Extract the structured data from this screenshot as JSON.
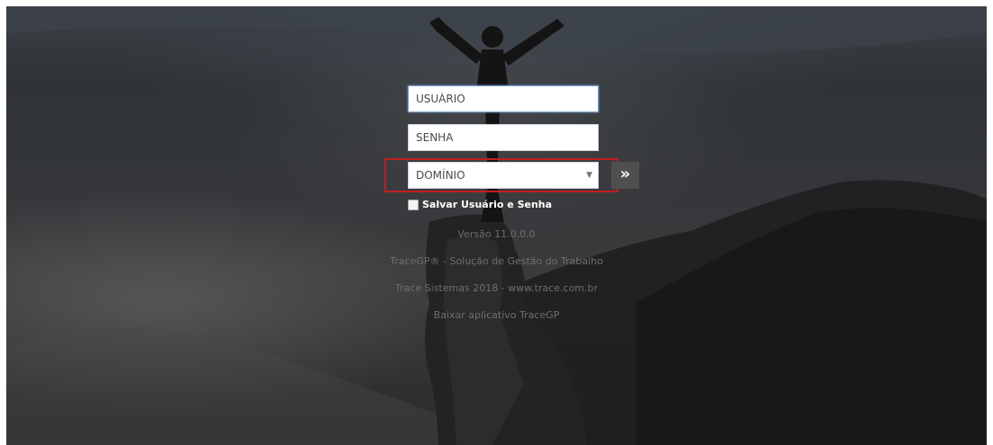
{
  "login": {
    "username_placeholder": "USUÁRIO",
    "password_placeholder": "SENHA",
    "domain_selected": "DOMÍNIO",
    "submit_glyph": "»",
    "remember_label": "Salvar Usuário e Senha"
  },
  "footer": {
    "version": "Versão 11.0.0.0",
    "product": "TraceGP® - Solução de Gestão do Trabalho",
    "company": "Trace Sistemas 2018 - www.trace.com.br",
    "download_link": "Baixar aplicativo TraceGP"
  },
  "colors": {
    "highlight_border": "#c01f1f",
    "focus_border": "#7f9fca",
    "button_bg": "#4f4f4f"
  }
}
